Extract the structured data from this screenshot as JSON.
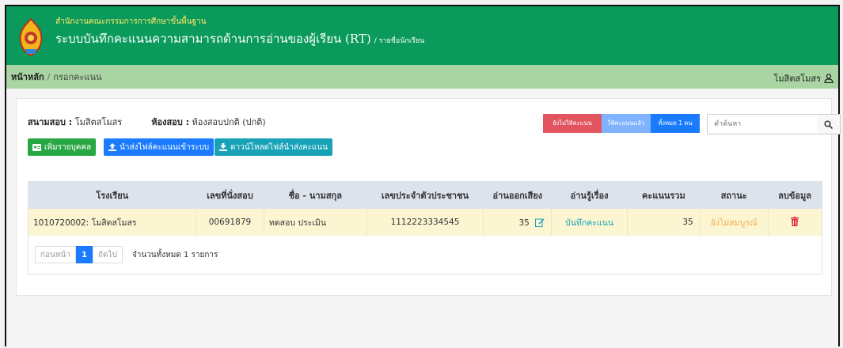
{
  "header": {
    "org": "สำนักงานคณะกรรมการการศึกษาขั้นพื้นฐาน",
    "system_title": "ระบบบันทึกคะแนนความสามารถด้านการอ่านของผู้เรียน (RT)",
    "system_sub": "/ รายชื่อนักเรียน"
  },
  "breadcrumb": {
    "home": "หน้าหลัก",
    "current": "กรอกคะแนน"
  },
  "user": {
    "name": "โมสิตสโมสร"
  },
  "info": {
    "venue_label": "สนามสอบ :",
    "venue_value": "โมสิตสโมสร",
    "room_label": "ห้องสอบ :",
    "room_value": "ห้องสอบปกติ (ปกติ)"
  },
  "buttons": {
    "add_individual": "เพิ่มรายบุคคล",
    "upload_score": "นำส่งไฟล์คะแนนเข้าระบบ",
    "download_file": "ดาวน์โหลดไฟล์นำส่งคะแนน"
  },
  "filters": {
    "not_scored": "ยังไม่ให้คะแนน",
    "scored": "ให้คะแนนแล้ว",
    "all": "ทั้งหมด 1 คน"
  },
  "search": {
    "placeholder": "คำค้นหา"
  },
  "table": {
    "headers": [
      "โรงเรียน",
      "เลขที่นั่งสอบ",
      "ชื่อ - นามสกุล",
      "เลขประจำตัวประชาชน",
      "อ่านออกเสียง",
      "อ่านรู้เรื่อง",
      "คะแนนรวม",
      "สถานะ",
      "ลบข้อมูล"
    ],
    "rows": [
      {
        "school": "1010720002: โมสิตสโมสร",
        "seat": "00691879",
        "name": "ทดสอบ ประเมิน",
        "citizen_id": "1112223334545",
        "oral": "35",
        "comprehension": "บันทึกคะแนน",
        "total": "35",
        "status": "ยังไม่สมบูรณ์"
      }
    ]
  },
  "pagination": {
    "prev": "ก่อนหน้า",
    "page": "1",
    "next": "ถัดไป",
    "total": "จำนวนทั้งหมด 1 รายการ"
  },
  "colors": {
    "header_green": "#0a9a5c",
    "breadcrumb_green": "#a8d5a2",
    "accent_blue": "#1a7bff",
    "danger_red": "#e25560",
    "warning": "#f0ad4e"
  },
  "icons": [
    "emblem-logo",
    "user-icon",
    "id-card-icon",
    "upload-icon",
    "download-icon",
    "search-icon",
    "edit-icon",
    "trash-icon"
  ]
}
